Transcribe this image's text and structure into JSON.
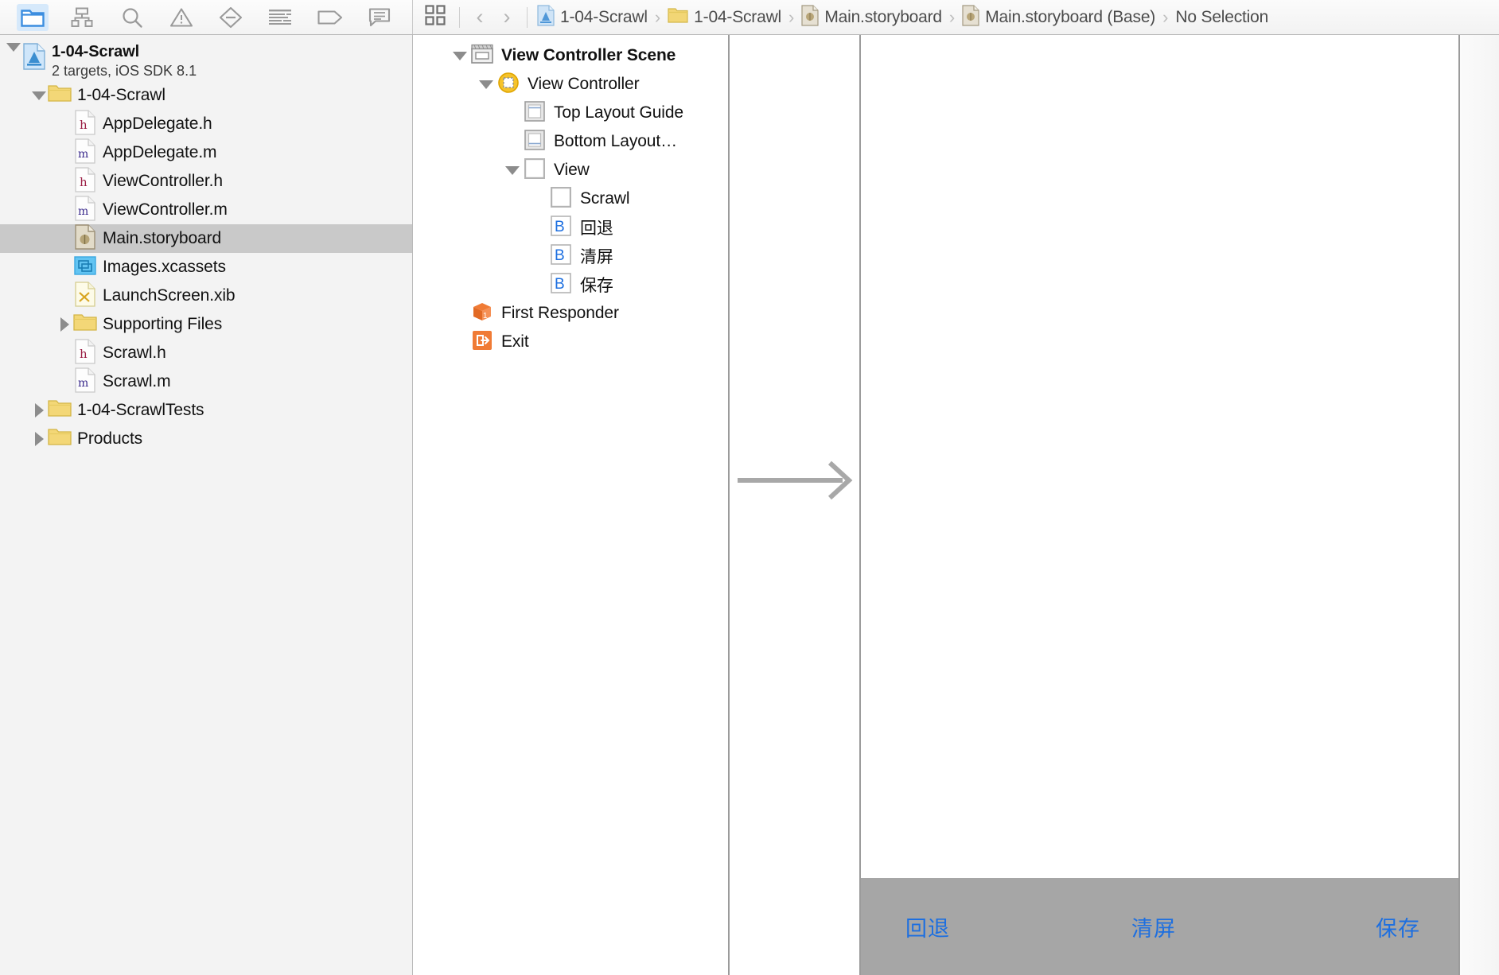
{
  "navigator_toolbar": {
    "tabs": [
      {
        "name": "project-navigator",
        "icon": "folder-icon",
        "active": true
      },
      {
        "name": "symbol-navigator",
        "icon": "hierarchy-icon",
        "active": false
      },
      {
        "name": "find-navigator",
        "icon": "search-icon",
        "active": false
      },
      {
        "name": "issue-navigator",
        "icon": "warning-triangle-icon",
        "active": false
      },
      {
        "name": "test-navigator",
        "icon": "diamond-minus-icon",
        "active": false
      },
      {
        "name": "debug-navigator",
        "icon": "list-lines-icon",
        "active": false
      },
      {
        "name": "breakpoint-navigator",
        "icon": "tag-icon",
        "active": false
      },
      {
        "name": "report-navigator",
        "icon": "speech-bubble-icon",
        "active": false
      }
    ]
  },
  "jumpbar": {
    "assistant_icon": "four-squares-icon",
    "back_label": "‹",
    "forward_label": "›",
    "separator_chevron": "›",
    "breadcrumbs": [
      {
        "label": "1-04-Scrawl",
        "icon": "xcode-project-icon"
      },
      {
        "label": "1-04-Scrawl",
        "icon": "folder-icon"
      },
      {
        "label": "Main.storyboard",
        "icon": "storyboard-file-icon"
      },
      {
        "label": "Main.storyboard (Base)",
        "icon": "storyboard-file-icon"
      },
      {
        "label": "No Selection",
        "icon": "none"
      }
    ]
  },
  "navigator": {
    "rows": [
      {
        "label": "1-04-Scrawl",
        "sublabel": "2 targets, iOS SDK 8.1",
        "indent": 0,
        "twisty": "down",
        "icon": "xcode-project-icon",
        "bold": true,
        "selected": false,
        "root": true
      },
      {
        "label": "1-04-Scrawl",
        "indent": 1,
        "twisty": "down",
        "icon": "folder-icon",
        "bold": false,
        "selected": false
      },
      {
        "label": "AppDelegate.h",
        "indent": 2,
        "twisty": "none",
        "icon": "header-file-icon",
        "bold": false,
        "selected": false
      },
      {
        "label": "AppDelegate.m",
        "indent": 2,
        "twisty": "none",
        "icon": "source-file-icon",
        "bold": false,
        "selected": false
      },
      {
        "label": "ViewController.h",
        "indent": 2,
        "twisty": "none",
        "icon": "header-file-icon",
        "bold": false,
        "selected": false
      },
      {
        "label": "ViewController.m",
        "indent": 2,
        "twisty": "none",
        "icon": "source-file-icon",
        "bold": false,
        "selected": false
      },
      {
        "label": "Main.storyboard",
        "indent": 2,
        "twisty": "none",
        "icon": "storyboard-file-icon",
        "bold": false,
        "selected": true
      },
      {
        "label": "Images.xcassets",
        "indent": 2,
        "twisty": "none",
        "icon": "xcassets-icon",
        "bold": false,
        "selected": false
      },
      {
        "label": "LaunchScreen.xib",
        "indent": 2,
        "twisty": "none",
        "icon": "xib-file-icon",
        "bold": false,
        "selected": false
      },
      {
        "label": "Supporting Files",
        "indent": 2,
        "twisty": "right",
        "icon": "folder-icon",
        "bold": false,
        "selected": false
      },
      {
        "label": "Scrawl.h",
        "indent": 2,
        "twisty": "none",
        "icon": "header-file-icon",
        "bold": false,
        "selected": false
      },
      {
        "label": "Scrawl.m",
        "indent": 2,
        "twisty": "none",
        "icon": "source-file-icon",
        "bold": false,
        "selected": false
      },
      {
        "label": "1-04-ScrawlTests",
        "indent": 1,
        "twisty": "right",
        "icon": "folder-icon",
        "bold": false,
        "selected": false
      },
      {
        "label": "Products",
        "indent": 1,
        "twisty": "right",
        "icon": "folder-icon",
        "bold": false,
        "selected": false
      }
    ]
  },
  "outline": {
    "rows": [
      {
        "label": "View Controller Scene",
        "indent": 0,
        "twisty": "down",
        "icon": "scene-icon",
        "bold": true
      },
      {
        "label": "View Controller",
        "indent": 1,
        "twisty": "down",
        "icon": "view-controller-icon",
        "bold": false
      },
      {
        "label": "Top Layout Guide",
        "indent": 2,
        "twisty": "none",
        "icon": "top-layout-guide-icon",
        "bold": false
      },
      {
        "label": "Bottom Layout…",
        "indent": 2,
        "twisty": "none",
        "icon": "bottom-layout-guide-icon",
        "bold": false
      },
      {
        "label": "View",
        "indent": 2,
        "twisty": "down",
        "icon": "view-icon",
        "bold": false
      },
      {
        "label": "Scrawl",
        "indent": 3,
        "twisty": "none",
        "icon": "view-icon",
        "bold": false
      },
      {
        "label": "回退",
        "indent": 3,
        "twisty": "none",
        "icon": "button-icon",
        "bold": false
      },
      {
        "label": "清屏",
        "indent": 3,
        "twisty": "none",
        "icon": "button-icon",
        "bold": false
      },
      {
        "label": "保存",
        "indent": 3,
        "twisty": "none",
        "icon": "button-icon",
        "bold": false
      },
      {
        "label": "First Responder",
        "indent": 0,
        "twisty": "none",
        "icon": "first-responder-icon",
        "bold": false
      },
      {
        "label": "Exit",
        "indent": 0,
        "twisty": "none",
        "icon": "exit-icon",
        "bold": false
      }
    ]
  },
  "canvas": {
    "segue_arrow_icon": "initial-scene-arrow-icon",
    "device_toolbar_color": "#a6a6a6",
    "button_color": "#1d6fe0",
    "buttons": [
      {
        "label": "回退",
        "name": "undo-button"
      },
      {
        "label": "清屏",
        "name": "clear-button"
      },
      {
        "label": "保存",
        "name": "save-button"
      }
    ]
  }
}
